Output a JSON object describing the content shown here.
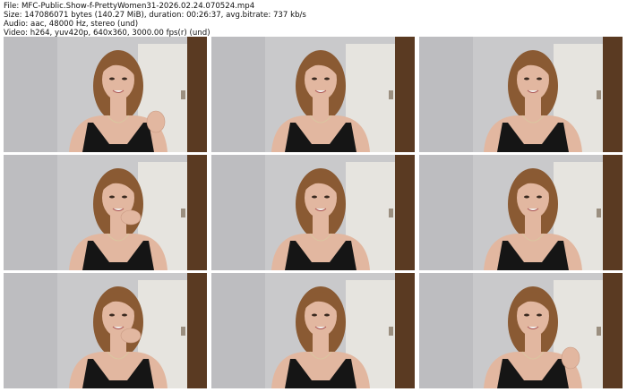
{
  "header": {
    "file": "File: MFC-Public.Show-f-PrettyWomen31-2026.02.24.070524.mp4",
    "size": "Size: 147086071 bytes (140.27 MiB), duration: 00:26:37, avg.bitrate: 737 kb/s",
    "audio": "Audio: aac, 48000 Hz, stereo (und)",
    "video": "Video: h264, yuv420p, 640x360, 3000.00 fps(r) (und)"
  },
  "thumbnails": [
    {
      "pose": "hand-raised-right"
    },
    {
      "pose": "neutral"
    },
    {
      "pose": "neutral"
    },
    {
      "pose": "hand-chin"
    },
    {
      "pose": "neutral"
    },
    {
      "pose": "neutral"
    },
    {
      "pose": "hand-chin"
    },
    {
      "pose": "neutral"
    },
    {
      "pose": "hand-raised-right"
    }
  ],
  "colors": {
    "wall": "#c9c9cb",
    "door": "#e6e4df",
    "wood": "#5a3a22",
    "hair": "#8a5a33",
    "skin": "#e2b7a0",
    "top": "#151515"
  }
}
